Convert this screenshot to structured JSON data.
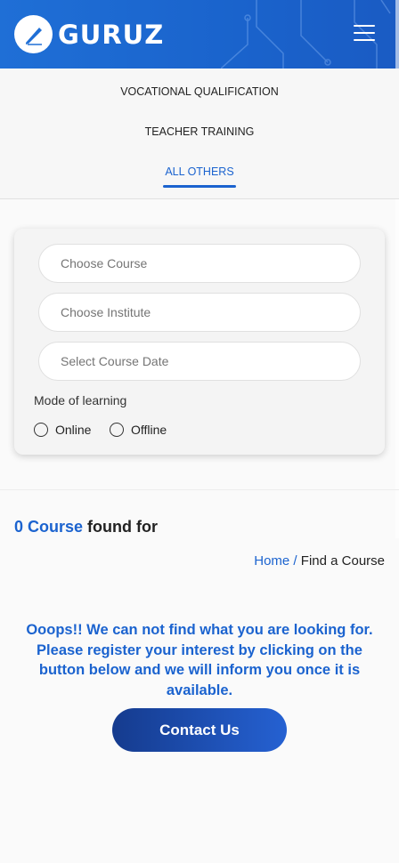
{
  "header": {
    "logo_text": "GURUZ",
    "menu_icon": "hamburger-menu-icon",
    "logo_icon": "pen-nib-logo-icon"
  },
  "tabs": [
    {
      "label": "VOCATIONAL QUALIFICATION",
      "active": false
    },
    {
      "label": "TEACHER TRAINING",
      "active": false
    },
    {
      "label": "ALL OTHERS",
      "active": true
    }
  ],
  "filters": {
    "course_placeholder": "Choose Course",
    "institute_placeholder": "Choose Institute",
    "date_placeholder": "Select Course Date",
    "mode_label": "Mode of learning",
    "modes": [
      "Online",
      "Offline"
    ]
  },
  "results": {
    "count_text": "0 Course",
    "suffix": " found for"
  },
  "breadcrumb": {
    "home": "Home",
    "separator": " / ",
    "current": "Find a Course"
  },
  "message": "Ooops!! We can not find what you are looking for. Please register your interest by clicking on the button below and we will inform you once it is available.",
  "contact_button": "Contact Us",
  "colors": {
    "accent": "#1b63cf",
    "header": "#1f6fd6"
  }
}
